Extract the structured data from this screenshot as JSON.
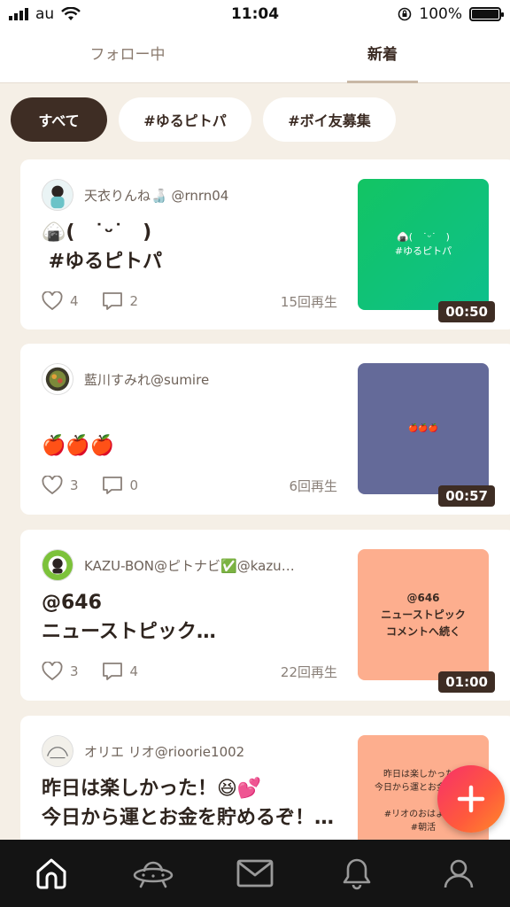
{
  "status_bar": {
    "carrier": "au",
    "time": "11:04",
    "battery": "100%",
    "battery_level": 1.0
  },
  "tabs": [
    {
      "label": "フォロー中",
      "active": false
    },
    {
      "label": "新着",
      "active": true
    }
  ],
  "filters": [
    {
      "label": "すべて",
      "active": true
    },
    {
      "label": "#ゆるピトパ",
      "active": false
    },
    {
      "label": "#ボイ友募集",
      "active": false
    }
  ],
  "posts": [
    {
      "user": "天衣りんね🍶 @rnrn04",
      "text": "🍙(　˙ᵕ˙　)\n #ゆるピトパ",
      "likes": "4",
      "comments": "2",
      "plays": "15回再生",
      "thumb_text": "🍙(　˙ᵕ˙　)\n#ゆるピトパ",
      "duration": "00:50",
      "thumb_color": "#10c670"
    },
    {
      "user": "藍川すみれ@sumire",
      "text": "\n🍎🍎🍎",
      "likes": "3",
      "comments": "0",
      "plays": "6回再生",
      "thumb_text": "🍎🍎🍎",
      "duration": "00:57",
      "thumb_color": "#646a99"
    },
    {
      "user": "KAZU-BON@ピトナビ✅@kazu…",
      "text": "@646\nニューストピック…",
      "likes": "3",
      "comments": "4",
      "plays": "22回再生",
      "thumb_text": "@646\nニューストピック\nコメントへ続く",
      "duration": "01:00",
      "thumb_color": "#fdae8e"
    },
    {
      "user": "オリエ リオ@rioorie1002",
      "text": "昨日は楽しかった！😆💕\n今日から運とお金を貯めるぞ！…",
      "thumb_text": "昨日は楽しかった！\n今日から運とお金を貯め\n\n#リオのおはようご\n#朝活",
      "thumb_color": "#fdae8e"
    }
  ],
  "colors": {
    "accent": "#3e2d24",
    "background": "#f5efe6",
    "fab": "#f7306a"
  },
  "nav": [
    "home-icon",
    "ufo-icon",
    "mail-icon",
    "bell-icon",
    "profile-icon"
  ]
}
